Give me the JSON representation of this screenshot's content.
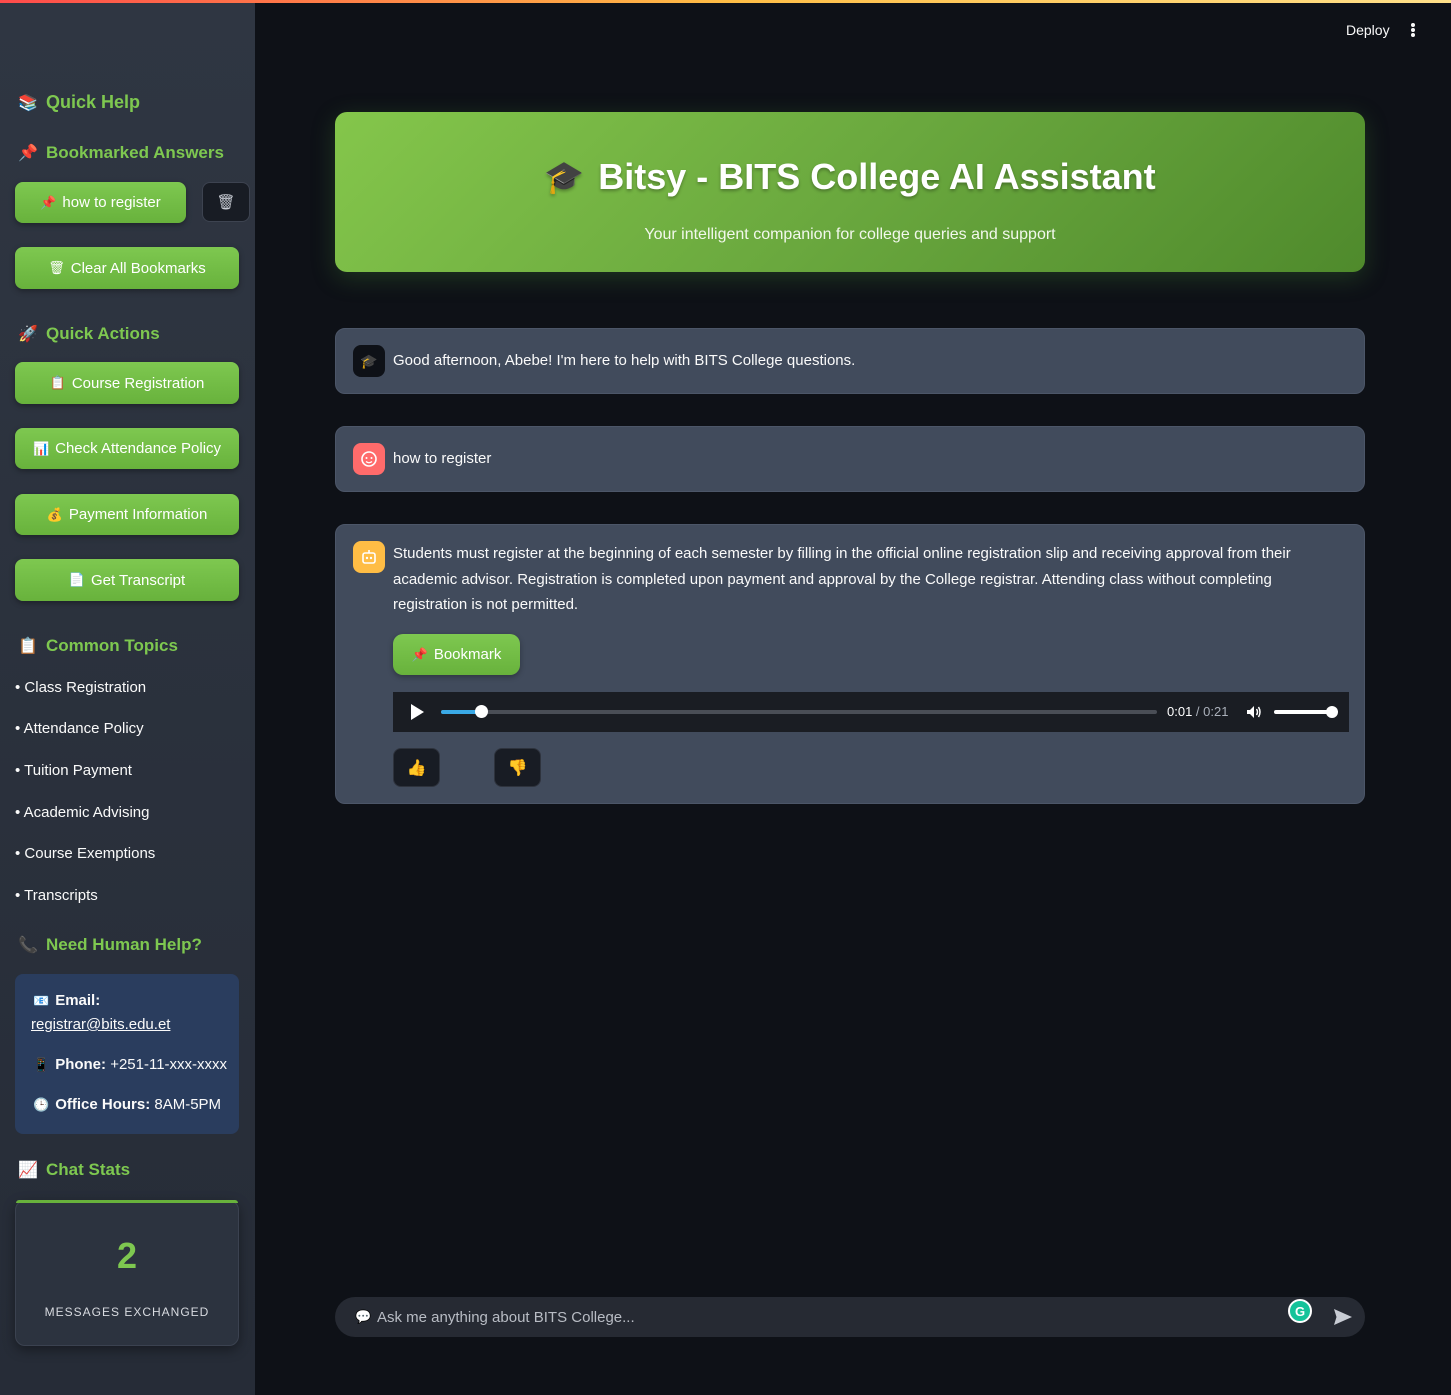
{
  "header": {
    "deploy_label": "Deploy"
  },
  "sidebar": {
    "quick_help_title": "Quick Help",
    "bookmarked_title": "Bookmarked Answers",
    "bookmarks": [
      "how to register"
    ],
    "clear_all_label": "Clear All Bookmarks",
    "quick_actions_title": "Quick Actions",
    "quick_actions": [
      "Course Registration",
      "Check Attendance Policy",
      "Payment Information",
      "Get Transcript"
    ],
    "common_topics_title": "Common Topics",
    "common_topics": [
      "• Class Registration",
      "• Attendance Policy",
      "• Tuition Payment",
      "• Academic Advising",
      "• Course Exemptions",
      "• Transcripts"
    ],
    "human_help_title": "Need Human Help?",
    "contact": {
      "email_label": "Email:",
      "email": "registrar@bits.edu.et",
      "phone_label": "Phone:",
      "phone": " +251-11-xxx-xxxx",
      "hours_label": "Office Hours:",
      "hours": " 8AM-5PM"
    },
    "chat_stats_title": "Chat Stats",
    "stats": {
      "count": "2",
      "label": "MESSAGES EXCHANGED"
    }
  },
  "hero": {
    "title": "Bitsy - BITS College AI Assistant",
    "subtitle": "Your intelligent companion for college queries and support"
  },
  "chat": {
    "greeting": "Good afternoon, Abebe! I'm here to help with BITS College questions.",
    "user_message": "how to register",
    "assistant_reply": "Students must register at the beginning of each semester by filling in the official online registration slip and receiving approval from their academic advisor. Registration is completed upon payment and approval by the College registrar. Attending class without completing registration is not permitted.",
    "bookmark_label": "Bookmark",
    "audio": {
      "current": "0:01",
      "separator": " / ",
      "duration": "0:21",
      "progress": 0.048,
      "volume": 1.0
    }
  },
  "input": {
    "placeholder": "Ask me anything about BITS College..."
  },
  "colors": {
    "accent_green": "#7ec850",
    "background": "#0e1117",
    "message_bg": "#414b5c",
    "contact_bg": "#2a3d5e"
  },
  "icons": {
    "quick_help": "books-icon",
    "bookmarked": "pushpin-icon",
    "trash": "wastebasket-icon",
    "quick_actions": "rocket-icon",
    "common_topics": "clipboard-icon",
    "human_help": "telephone-icon",
    "chat_stats": "chart-increasing-icon",
    "thumbs_up": "thumbs-up-icon",
    "thumbs_down": "thumbs-down-icon"
  }
}
